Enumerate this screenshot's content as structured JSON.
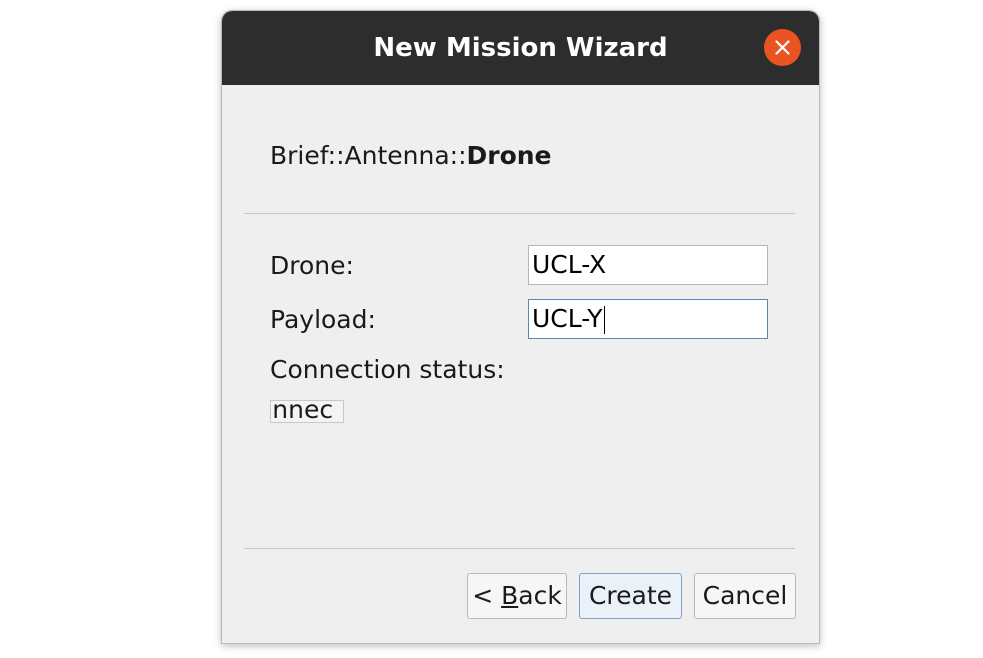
{
  "window": {
    "title": "New Mission Wizard",
    "close_icon": "close-icon"
  },
  "breadcrumb": {
    "prefix": "Brief::Antenna::",
    "current": "Drone"
  },
  "form": {
    "drone_label": "Drone:",
    "drone_value": "UCL-X",
    "payload_label": "Payload:",
    "payload_value": "UCL-Y",
    "connection_label": "Connection status:",
    "connection_value_visible": "onnec"
  },
  "buttons": {
    "back_prefix": "< ",
    "back_mnemonic": "B",
    "back_rest": "ack",
    "create": "Create",
    "cancel": "Cancel"
  },
  "colors": {
    "titlebar": "#2d2d2d",
    "close_button": "#e95420",
    "dialog_bg": "#efefef",
    "focus_border": "#5b87bb"
  }
}
